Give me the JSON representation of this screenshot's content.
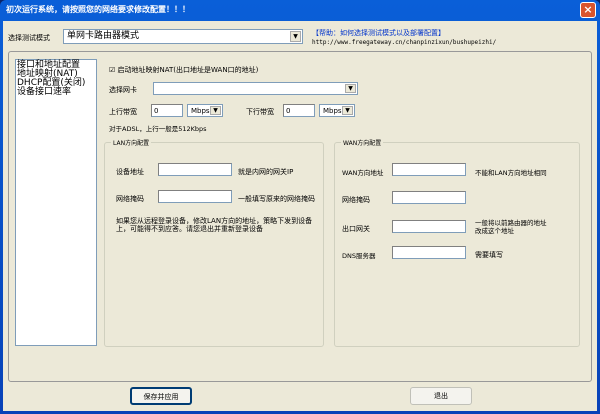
{
  "window": {
    "title": "初次运行系统，请按照您的网络要求修改配置！！！"
  },
  "mode": {
    "label": "选择测试模式",
    "value": "单网卡路由器模式"
  },
  "help": {
    "link": "【帮助：如何选择测试模式以及部署配置】",
    "url": "http://www.freegateway.cn/chanpinzixun/bushupeizhi/"
  },
  "sidebar": {
    "items": [
      {
        "label": "接口和地址配置"
      },
      {
        "label": "地址映射(NAT)"
      },
      {
        "label": "DHCP配置(关闭)"
      },
      {
        "label": "设备接口速率"
      }
    ]
  },
  "nat": {
    "checked": true,
    "label": "启动地址映射NAT(出口地址是WAN口的地址)"
  },
  "nic": {
    "label": "选择网卡",
    "value": ""
  },
  "bandwidth": {
    "up_label": "上行带宽",
    "up_value": "0",
    "up_unit": "Mbps",
    "down_label": "下行带宽",
    "down_value": "0",
    "down_unit": "Mbps",
    "note": "对于ADSL，上行一般是512Kbps"
  },
  "lan": {
    "title": "LAN方向配置",
    "addr_label": "设备地址",
    "addr_hint": "就是内网的网关IP",
    "mask_label": "网络掩码",
    "mask_hint": "一般填写原来的网络掩码",
    "warning": "如果您从远程登录设备，修改LAN方向的地址，策略下发到设备上，可能得不到应答。请您退出并重新登录设备"
  },
  "wan": {
    "title": "WAN方向配置",
    "addr_label": "WAN方向地址",
    "addr_hint": "不能和LAN方向地址相同",
    "mask_label": "网络掩码",
    "gw_label": "出口网关",
    "gw_hint": "一般将以前路由器的地址改成这个地址",
    "dns_label": "DNS服务器",
    "dns_hint": "需要填写"
  },
  "buttons": {
    "save": "保存并应用",
    "exit": "退出"
  }
}
